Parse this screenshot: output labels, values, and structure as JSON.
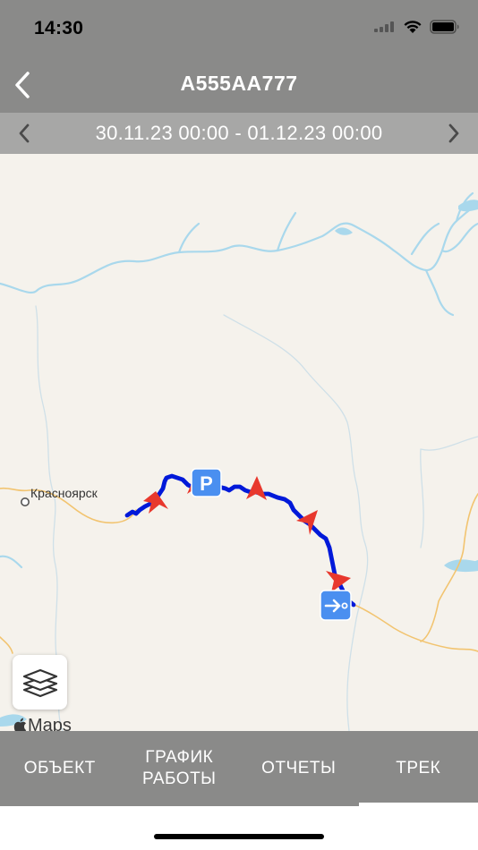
{
  "status_bar": {
    "time": "14:30"
  },
  "header": {
    "title": "А555АА777"
  },
  "date_range": {
    "label": "30.11.23 00:00 - 01.12.23 00:00"
  },
  "map": {
    "city_label": "Красноярск",
    "attribution": "Maps",
    "track_color": "#0019d9",
    "marker_color": "#e8382d",
    "badge_color": "#4a8ff0",
    "parking_label": "P"
  },
  "tabs": [
    {
      "label": "ОБЪЕКТ",
      "active": false
    },
    {
      "label": "ГРАФИК РАБОТЫ",
      "active": false
    },
    {
      "label": "ОТЧЕТЫ",
      "active": false
    },
    {
      "label": "ТРЕК",
      "active": true
    }
  ]
}
